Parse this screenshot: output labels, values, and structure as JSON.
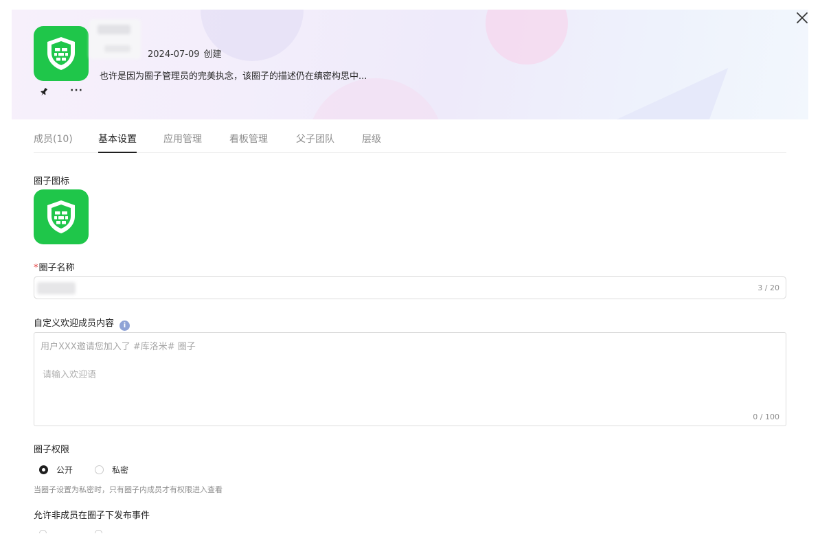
{
  "header": {
    "created_date": "2024-07-09",
    "created_label": "创建",
    "description": "也许是因为圈子管理员的完美执念，该圈子的描述仍在缜密构思中...",
    "more_label": "···"
  },
  "tabs": [
    {
      "label": "成员(10)"
    },
    {
      "label": "基本设置"
    },
    {
      "label": "应用管理"
    },
    {
      "label": "看板管理"
    },
    {
      "label": "父子团队"
    },
    {
      "label": "层级"
    }
  ],
  "form": {
    "icon_label": "圈子图标",
    "name_required_mark": "*",
    "name_label": "圈子名称",
    "name_counter": "3 / 20",
    "welcome_label": "自定义欢迎成员内容",
    "welcome_info": "i",
    "welcome_prefix": "用户XXX邀请您加入了 #库洛米# 圈子",
    "welcome_placeholder": "请输入欢迎语",
    "welcome_counter": "0 / 100",
    "permission_label": "圈子权限",
    "permission_options": [
      {
        "label": "公开",
        "checked": true
      },
      {
        "label": "私密",
        "checked": false
      }
    ],
    "permission_hint": "当圈子设置为私密时，只有圈子内成员才有权限进入查看",
    "publish_label": "允许非成员在圈子下发布事件"
  },
  "colors": {
    "brand_green": "#1fc64a",
    "required_red": "#e23b3b",
    "info_blue": "#8fa3d6"
  }
}
